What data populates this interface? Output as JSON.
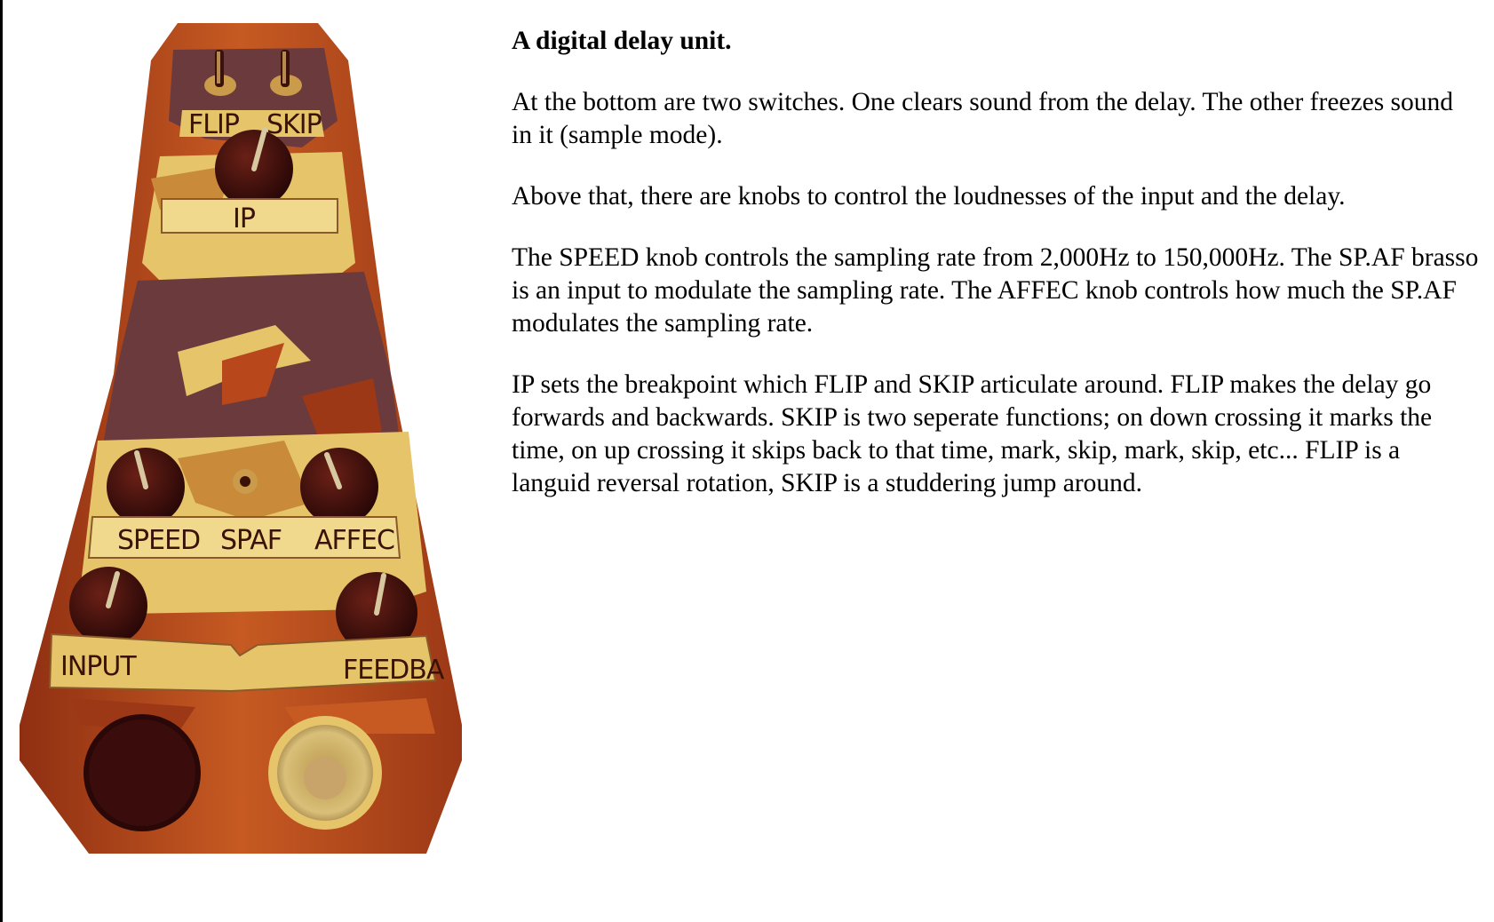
{
  "figure": {
    "switch_labels": [
      "FLIP",
      "SKIP"
    ],
    "ip_label": "IP",
    "knob_labels": [
      "SPEED",
      "SPAF",
      "AFFEC"
    ],
    "bottom_labels": [
      "INPUT",
      "FEEDBA"
    ],
    "colors": {
      "body_orange": "#b8471c",
      "panel_yellow": "#e6c46a",
      "dark_brown": "#3a1208",
      "purple_brown": "#6b3a3c"
    }
  },
  "text": {
    "heading": "A digital delay unit.",
    "paragraphs": [
      "At the bottom are two switches. One clears sound from the delay. The other freezes sound in it (sample mode).",
      "Above that, there are knobs to control the loudnesses of the input and the delay.",
      "The SPEED knob controls the sampling rate from 2,000Hz to 150,000Hz. The SP.AF brasso is an input to modulate the sampling rate. The AFFEC knob controls how much the SP.AF modulates the sampling rate.",
      "IP sets the breakpoint which FLIP and SKIP articulate around. FLIP makes the delay go forwards and backwards. SKIP is two seperate functions; on down crossing it marks the time, on up crossing it skips back to that time, mark, skip, mark, skip, etc... FLIP is a languid reversal rotation, SKIP is a studdering jump around."
    ]
  }
}
